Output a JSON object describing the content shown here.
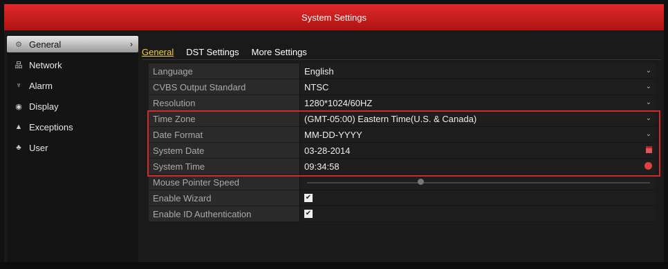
{
  "window": {
    "title": "System Settings"
  },
  "sidebar": {
    "items": [
      {
        "label": "General",
        "icon": "gear-icon",
        "active": true
      },
      {
        "label": "Network",
        "icon": "network-icon"
      },
      {
        "label": "Alarm",
        "icon": "alarm-icon"
      },
      {
        "label": "Display",
        "icon": "eye-icon"
      },
      {
        "label": "Exceptions",
        "icon": "warning-icon"
      },
      {
        "label": "User",
        "icon": "users-icon"
      }
    ]
  },
  "tabs": [
    {
      "label": "General",
      "active": true
    },
    {
      "label": "DST Settings"
    },
    {
      "label": "More Settings"
    }
  ],
  "settings": {
    "language": {
      "label": "Language",
      "value": "English"
    },
    "cvbs": {
      "label": "CVBS Output Standard",
      "value": "NTSC"
    },
    "resolution": {
      "label": "Resolution",
      "value": "1280*1024/60HZ"
    },
    "timezone": {
      "label": "Time Zone",
      "value": "(GMT-05:00) Eastern Time(U.S. & Canada)"
    },
    "date_format": {
      "label": "Date Format",
      "value": "MM-DD-YYYY"
    },
    "system_date": {
      "label": "System Date",
      "value": "03-28-2014"
    },
    "system_time": {
      "label": "System Time",
      "value": "09:34:58"
    },
    "mouse_speed": {
      "label": "Mouse Pointer Speed"
    },
    "wizard": {
      "label": "Enable Wizard",
      "checked": true
    },
    "id_auth": {
      "label": "Enable ID Authentication",
      "checked": true
    }
  },
  "colors": {
    "accent": "#c81818",
    "active_tab": "#f0d23c",
    "highlight_box": "#d12a2a"
  }
}
